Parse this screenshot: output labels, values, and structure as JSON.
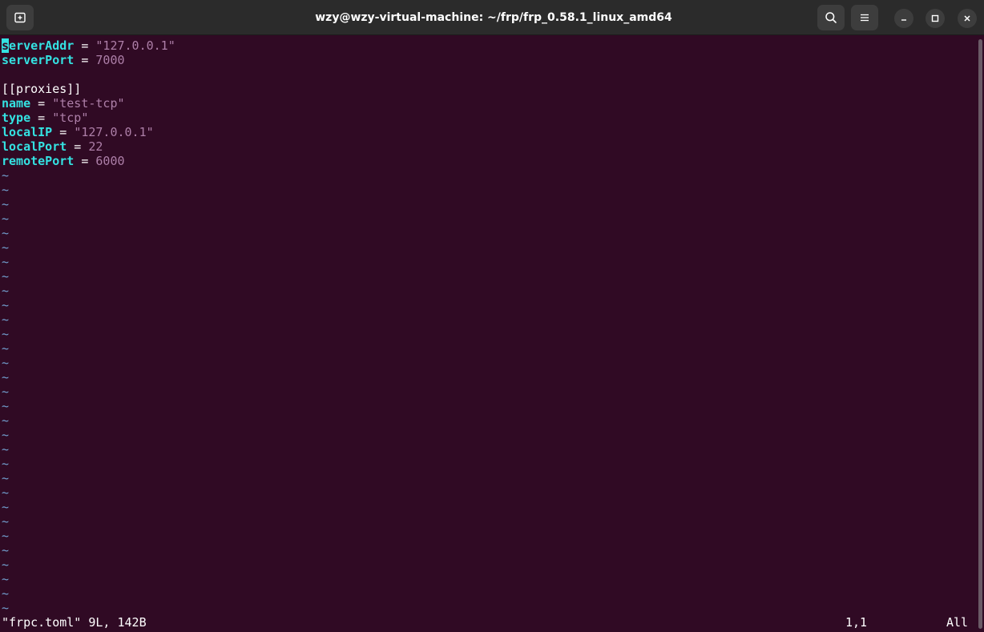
{
  "window": {
    "title": "wzy@wzy-virtual-machine: ~/frp/frp_0.58.1_linux_amd64"
  },
  "titlebar_icons": {
    "new_tab": "new-tab-icon",
    "search": "search-icon",
    "menu": "hamburger-menu-icon",
    "minimize": "minimize-icon",
    "maximize": "maximize-icon",
    "close": "close-icon"
  },
  "editor": {
    "lines": [
      {
        "kind": "kv",
        "key": "serverAddr",
        "op": " = ",
        "value": "\"127.0.0.1\"",
        "vtype": "str"
      },
      {
        "kind": "kv",
        "key": "serverPort",
        "op": " = ",
        "value": "7000",
        "vtype": "num"
      },
      {
        "kind": "blank"
      },
      {
        "kind": "section",
        "text": "[[proxies]]"
      },
      {
        "kind": "kv",
        "key": "name",
        "op": " = ",
        "value": "\"test-tcp\"",
        "vtype": "str"
      },
      {
        "kind": "kv",
        "key": "type",
        "op": " = ",
        "value": "\"tcp\"",
        "vtype": "str"
      },
      {
        "kind": "kv",
        "key": "localIP",
        "op": " = ",
        "value": "\"127.0.0.1\"",
        "vtype": "str"
      },
      {
        "kind": "kv",
        "key": "localPort",
        "op": " = ",
        "value": "22",
        "vtype": "num"
      },
      {
        "kind": "kv",
        "key": "remotePort",
        "op": " = ",
        "value": "6000",
        "vtype": "num"
      }
    ],
    "empty_line_marker": "~",
    "empty_line_count": 31
  },
  "status": {
    "message": "\"frpc.toml\" 9L, 142B",
    "position": "1,1",
    "percent": "All"
  },
  "colors": {
    "background": "#300a24",
    "key": "#34e2e2",
    "value": "#ad7fa8",
    "tilde": "#729fcf",
    "titlebar": "#2b2b2b"
  }
}
